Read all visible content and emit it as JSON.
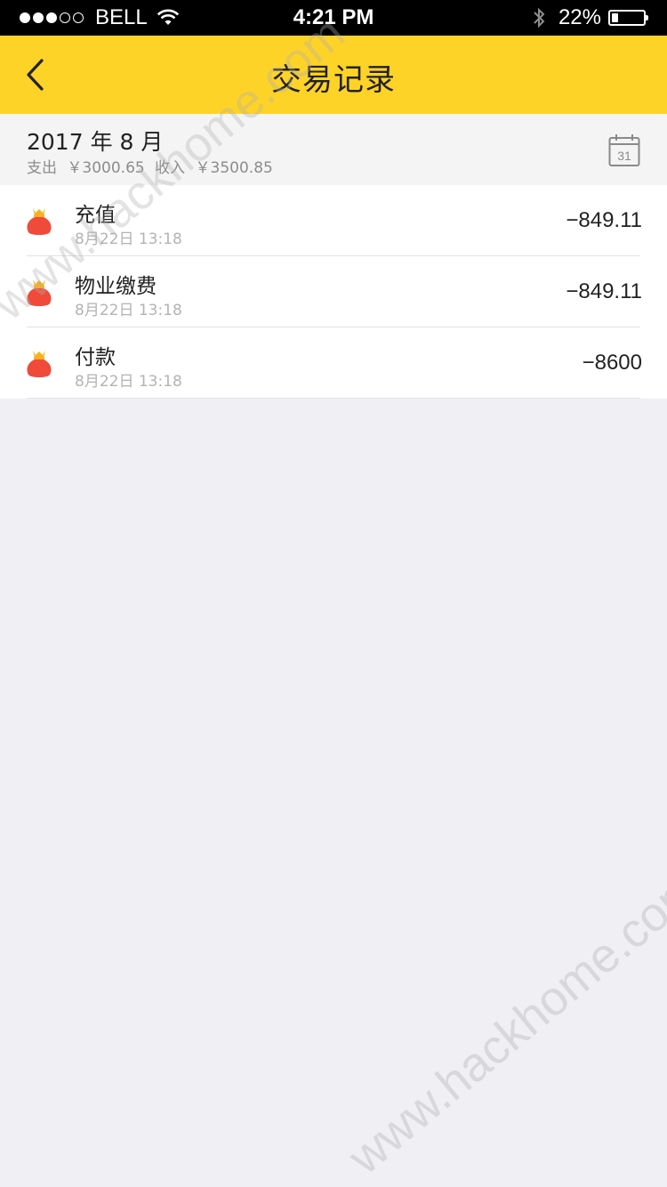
{
  "status_bar": {
    "carrier": "BELL",
    "time": "4:21 PM",
    "battery_percent": "22%",
    "battery_level": 0.22,
    "signal_bars": 3,
    "signal_total": 5
  },
  "nav": {
    "title": "交易记录",
    "back_icon": "chevron-left-icon"
  },
  "month": {
    "title": "2017 年 8 月",
    "expense_label": "支出",
    "expense_value": "￥3000.65",
    "income_label": "收入",
    "income_value": "￥3500.85",
    "calendar_day": "31"
  },
  "transactions": [
    {
      "name": "充值",
      "time": "8月22日 13:18",
      "amount": "−849.11"
    },
    {
      "name": "物业缴费",
      "time": "8月22日 13:18",
      "amount": "−849.11"
    },
    {
      "name": "付款",
      "time": "8月22日 13:18",
      "amount": "−8600"
    }
  ],
  "watermark": {
    "text": "www.hackhome.com"
  },
  "colors": {
    "nav_background": "#fed328",
    "page_background": "#efeff4",
    "icon_red": "#f04a3a",
    "icon_gold": "#f7b21c"
  }
}
